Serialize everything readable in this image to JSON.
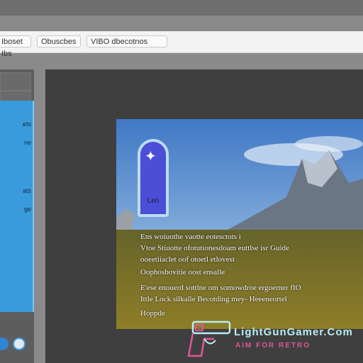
{
  "toolbar": {
    "item1": "Iboset Ibs",
    "item2": "Obuscbes",
    "item3": "VIBO dbecotnos"
  },
  "sidebar": {
    "panel_lines": [
      "ets",
      "ne",
      "ats",
      "ge"
    ]
  },
  "image": {
    "badge_label": "Len",
    "caption_lines": [
      "Ens woiuothe vaotte eotesctots i",
      "Vtoe Stiuotte ofotutionesdoam euttlse isr Guide",
      "ooeetiiaclet oof otoetl etlovest",
      "Oophosbovitie oost ensalle",
      "E'ese enouerd sottlne om somowdroe ergoerner fIO",
      "Ittle Lock silkalle Becotding mey- Heeeneortel",
      "Hoppde"
    ]
  },
  "watermark": {
    "title": "LightGunGamer.Com",
    "tagline": "AIM FOR RETRO"
  },
  "colors": {
    "sidebar_accent": "#3a9bdc",
    "badge": "#4b4ed6",
    "watermark_cyan": "#b8eef3",
    "watermark_pink": "#e0569a"
  }
}
